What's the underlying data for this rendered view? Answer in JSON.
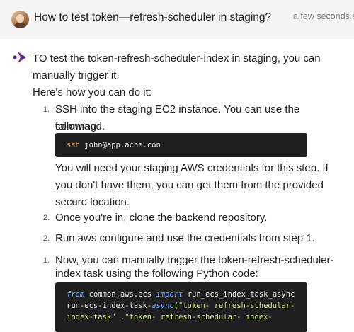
{
  "header": {
    "question": "How to test token—refresh-scheduler in staging?",
    "timestamp": "a few seconds ag"
  },
  "answer": {
    "intro_line1": "TO test the token-refresh-scheduler-index in staging, you can",
    "intro_line2": "manually trigger it.",
    "intro_line3": "Here's how you can do it:",
    "steps": [
      {
        "num": "1.",
        "line1": "SSH into the staging EC2 instance. You can use the following",
        "line2": "command.",
        "code": {
          "cmd": "ssh",
          "arg": "john@app.acne.con"
        },
        "after_line1": "You will need your staging AWS credentials for this step. If",
        "after_line2": "you don't have them, you can get them from the provided",
        "after_line3": "secure location."
      },
      {
        "num": "2.",
        "line1": "Once you're in, clone the backend repository."
      },
      {
        "num": "2.",
        "line1": "Run aws configure and use the credentials from step 1."
      },
      {
        "num": "1.",
        "line1": "Now, you can manually trigger the token-refresh-scheduler-",
        "line2": "index task using the following Python code:",
        "code": {
          "l1_from": "from",
          "l1_module": " common.aws.ecs ",
          "l1_import": "import",
          "l1_name": " run_ecs_index_task_async",
          "l2_pre": "run-ecs-index-task-",
          "l2_fn": "async",
          "l2_str": "(\"token- refresh-schedular-",
          "l3_str": "index-task\" ,\"token- refresh-schedular- index-"
        }
      }
    ]
  },
  "colors": {
    "bot_icon": "#5b2d8e",
    "header_bg": "#f4f4f4",
    "code_bg": "#1f1f1f"
  },
  "icons": {
    "avatar": "user-avatar",
    "bot": "assistant-chevron-icon"
  }
}
